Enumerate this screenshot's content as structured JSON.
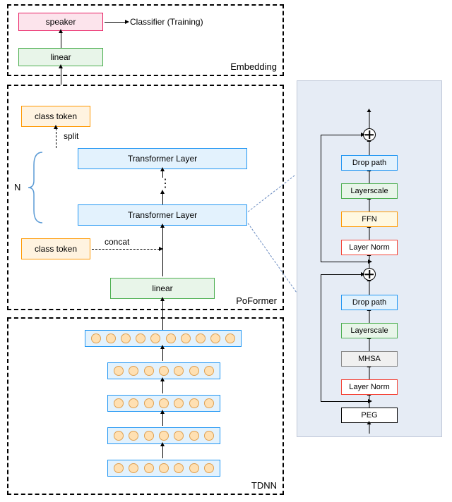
{
  "embedding": {
    "label": "Embedding",
    "speaker": "speaker",
    "linear": "linear",
    "classifier": "Classifier (Training)"
  },
  "poformer": {
    "label": "PoFormer",
    "class_token_top": "class token",
    "class_token_bottom": "class token",
    "split": "split",
    "concat": "concat",
    "transformer_top": "Transformer Layer",
    "transformer_bottom": "Transformer Layer",
    "linear": "linear",
    "n_label": "N"
  },
  "tdnn": {
    "label": "TDNN"
  },
  "detail": {
    "drop_path_top": "Drop path",
    "layerscale_top": "Layerscale",
    "ffn": "FFN",
    "layer_norm_top": "Layer Norm",
    "drop_path_bottom": "Drop path",
    "layerscale_bottom": "Layerscale",
    "mhsa": "MHSA",
    "layer_norm_bottom": "Layer Norm",
    "peg": "PEG"
  },
  "chart_data": {
    "type": "diagram",
    "architecture": {
      "modules": [
        {
          "name": "TDNN",
          "layers": 5,
          "widths": [
            7,
            7,
            7,
            7,
            10
          ],
          "output_to": "PoFormer"
        },
        {
          "name": "PoFormer",
          "components": [
            "linear",
            "concat class token",
            "Transformer Layer × N",
            "split class token"
          ],
          "output_to": "Embedding"
        },
        {
          "name": "Embedding",
          "components": [
            "linear",
            "speaker"
          ],
          "speaker_to": "Classifier (Training)"
        }
      ],
      "transformer_layer_detail": [
        "PEG",
        "Layer Norm",
        "MHSA",
        "Layerscale",
        "Drop path",
        "residual-add",
        "Layer Norm",
        "FFN",
        "Layerscale",
        "Drop path",
        "residual-add"
      ]
    }
  }
}
